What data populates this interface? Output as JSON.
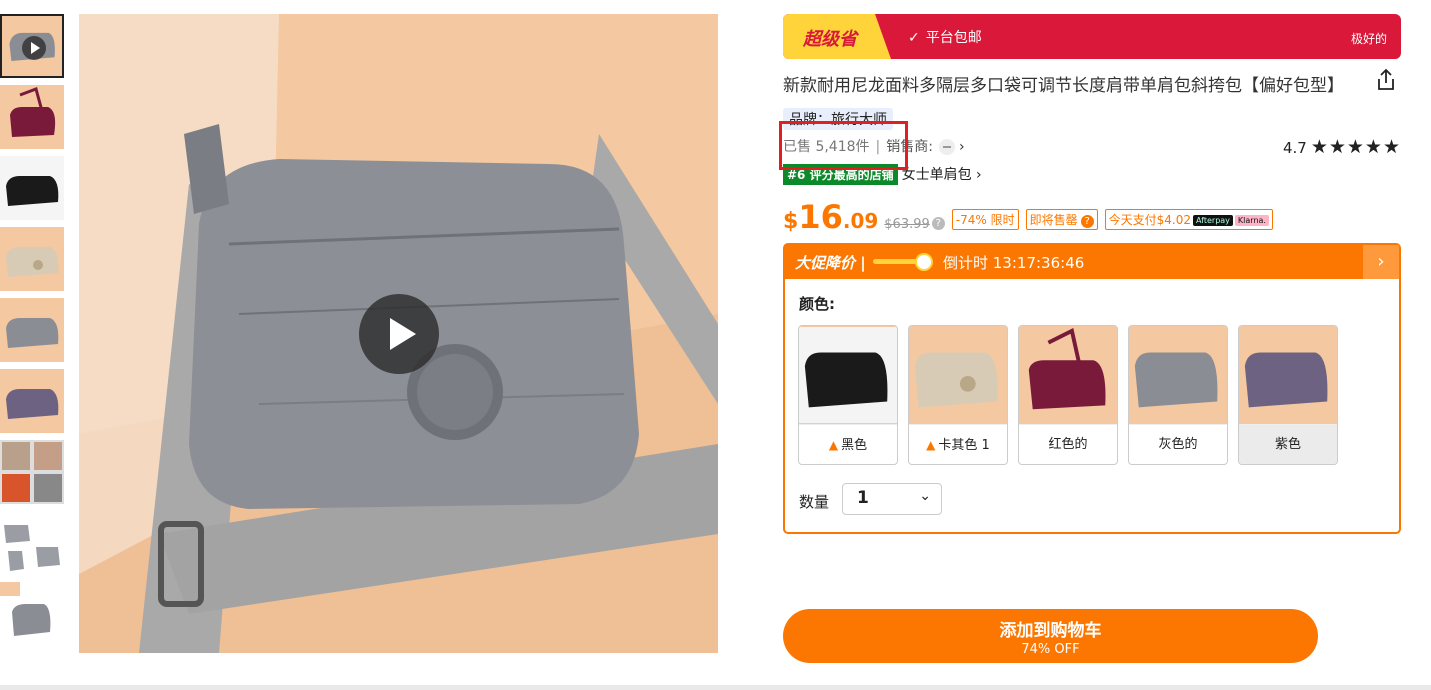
{
  "promo": {
    "super_label": "超级省",
    "free_shipping": "平台包邮",
    "best": "极好的"
  },
  "product": {
    "title": "新款耐用尼龙面料多隔层多口袋可调节长度肩带单肩包斜挎包【偏好包型】",
    "brand": "品牌：旅行大师",
    "sold": "已售 5,418件",
    "seller_label": "销售商:",
    "rating": "4.7",
    "stars": "★★★★★",
    "rank_badge": "#6 评分最高的店铺",
    "rank_category": "女士单肩包"
  },
  "price": {
    "currency": "$",
    "integer": "16",
    "decimal": ".09",
    "original": "$63.99",
    "discount_chip": "-74% 限时",
    "selling_fast_chip": "即将售罄",
    "pay_today": "今天支付$4.02",
    "pay_afterpay": "Afterpay",
    "pay_klarna": "Klarna."
  },
  "deal": {
    "big_sale": "大促降价",
    "divider": "|",
    "countdown": "倒计时 13:17:36:46"
  },
  "colors": {
    "label": "颜色:",
    "options": [
      {
        "name": "黑色",
        "hot": true,
        "color": "#1a1a1a"
      },
      {
        "name": "卡其色 1",
        "hot": true,
        "color": "#d8cbb5"
      },
      {
        "name": "红色的",
        "hot": false,
        "color": "#7a1a3a"
      },
      {
        "name": "灰色的",
        "hot": false,
        "color": "#8a8d94"
      },
      {
        "name": "紫色",
        "hot": false,
        "color": "#6d6282"
      }
    ],
    "selected": "紫色"
  },
  "quantity": {
    "label": "数量",
    "value": "1"
  },
  "cart": {
    "label": "添加到购物车",
    "off": "74% OFF"
  },
  "theme": {
    "accent": "#fb7701",
    "promo_red": "#d9183a",
    "highlight": "#e02020"
  }
}
